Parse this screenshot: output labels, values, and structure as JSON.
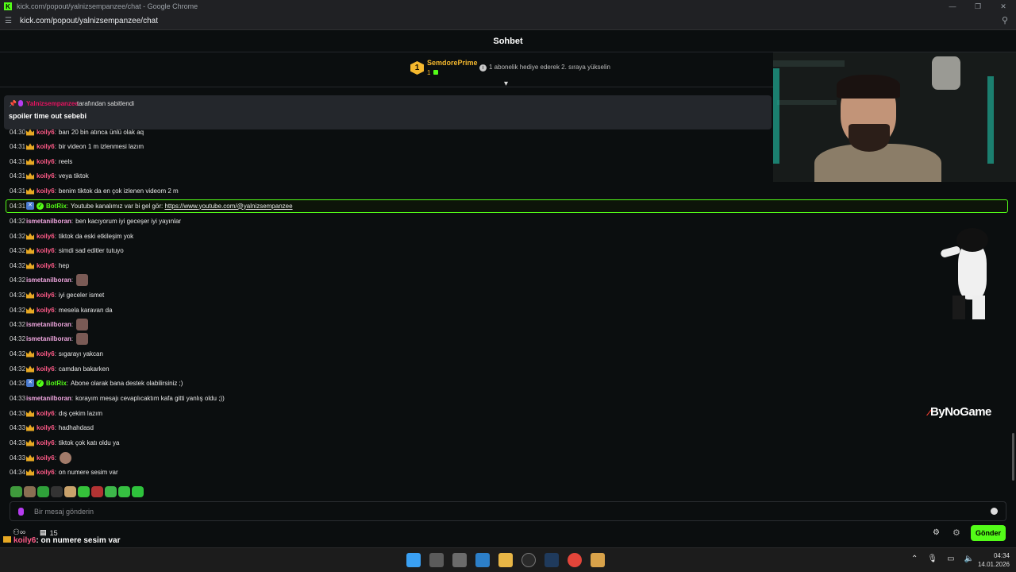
{
  "browser": {
    "window_title": "kick.com/popout/yalnizsempanzee/chat - Google Chrome",
    "url": "kick.com/popout/yalnizsempanzee/chat",
    "favicon_letter": "K",
    "controls": [
      "—",
      "❐",
      "✕"
    ]
  },
  "chat": {
    "title": "Sohbet",
    "leaderboard": {
      "rank": "1",
      "name": "SemdorePrime",
      "count": "1",
      "hint": "1 abonelik hediye ederek 2. sıraya yükselin"
    },
    "pinned": {
      "pinned_by_name": "Yalnizsempanzee",
      "pinned_by_text": "tarafından sabitlendi",
      "message": "spoiler time out sebebi"
    },
    "messages": [
      {
        "time": "04:30",
        "user": "koily6",
        "text": "barı 20 bin atınca ünlü olak aq"
      },
      {
        "time": "04:31",
        "user": "koily6",
        "text": "bir videon 1 m izlenmesi lazım"
      },
      {
        "time": "04:31",
        "user": "koily6",
        "text": "reels"
      },
      {
        "time": "04:31",
        "user": "koily6",
        "text": "veya tiktok"
      },
      {
        "time": "04:31",
        "user": "koily6",
        "text": "benim tiktok da en çok izlenen videom 2 m"
      },
      {
        "time": "04:31",
        "user": "BotRix",
        "text": "Youtube kanalımız var bi gel gör:",
        "link": "https://www.youtube.com/@yalnizsempanzee"
      },
      {
        "time": "04:32",
        "user": "ismetanilboran",
        "text": "ben kacıyorum iyi geceşer iyi yayınlar"
      },
      {
        "time": "04:32",
        "user": "koily6",
        "text": "tiktok da eski etkileşim yok"
      },
      {
        "time": "04:32",
        "user": "koily6",
        "text": "simdi sad editler tutuyo"
      },
      {
        "time": "04:32",
        "user": "koily6",
        "text": "hep"
      },
      {
        "time": "04:32",
        "user": "ismetanilboran",
        "text": ""
      },
      {
        "time": "04:32",
        "user": "koily6",
        "text": "iyi geceler ismet"
      },
      {
        "time": "04:32",
        "user": "koily6",
        "text": "mesela karavan da"
      },
      {
        "time": "04:32",
        "user": "ismetanilboran",
        "text": ""
      },
      {
        "time": "04:32",
        "user": "ismetanilboran",
        "text": ""
      },
      {
        "time": "04:32",
        "user": "koily6",
        "text": "sıgarayı yakcan"
      },
      {
        "time": "04:32",
        "user": "koily6",
        "text": "camdan bakarken"
      },
      {
        "time": "04:32",
        "user": "BotRix",
        "text": "Abone olarak bana destek olabilirsiniz ;)"
      },
      {
        "time": "04:33",
        "user": "ismetanilboran",
        "text": "korayım mesajı cevaplıcaktım kafa gitti yanlış oldu ;))"
      },
      {
        "time": "04:33",
        "user": "koily6",
        "text": "dış çekim lazım"
      },
      {
        "time": "04:33",
        "user": "koily6",
        "text": "hadhahdasd"
      },
      {
        "time": "04:33",
        "user": "koily6",
        "text": "tiktok çok katı oldu ya"
      },
      {
        "time": "04:33",
        "user": "koily6",
        "text": ""
      },
      {
        "time": "04:34",
        "user": "koily6",
        "text": "on numere sesim var"
      }
    ],
    "input_placeholder": "Bir mesaj gönderin",
    "viewer_count": "15",
    "send_label": "Gönder",
    "last_message_user": "koily6",
    "last_message_text": ": on numere sesim var"
  },
  "watermark": "ByNoGame",
  "taskbar": {
    "time": "04:34",
    "date": "14.01.2026"
  },
  "colors": {
    "kick_green": "#53fc18",
    "username_pink": "#ff5b88",
    "bg": "#0b0e0f"
  }
}
